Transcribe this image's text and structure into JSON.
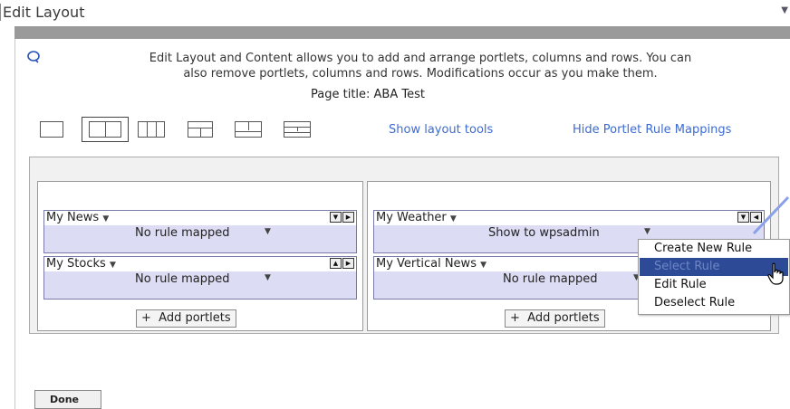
{
  "window": {
    "title": "Edit Layout"
  },
  "info": {
    "line1": "Edit Layout and Content allows you to add and arrange portlets, columns and rows. You can",
    "line2": "also remove portlets, columns and rows. Modifications occur as you make them."
  },
  "page_title": "Page title: ABA Test",
  "layout_options": [
    "one-column",
    "two-column",
    "three-column",
    "top-and-two-columns",
    "two-rows-two-columns",
    "two-rows-split"
  ],
  "selected_layout": "two-column",
  "links": {
    "show_layout_tools": "Show layout tools",
    "hide_rule_mappings": "Hide Portlet Rule Mappings"
  },
  "columns": [
    {
      "portlets": [
        {
          "title": "My News",
          "rule": "No rule mapped"
        },
        {
          "title": "My Stocks",
          "rule": "No rule mapped"
        }
      ],
      "add_label": "Add portlets"
    },
    {
      "portlets": [
        {
          "title": "My Weather",
          "rule": "Show to wpsadmin"
        },
        {
          "title": "My Vertical News",
          "rule": "No rule mapped"
        }
      ],
      "add_label": "Add portlets"
    }
  ],
  "context_menu": {
    "items": [
      "Create New Rule",
      "Select Rule",
      "Edit Rule",
      "Deselect Rule"
    ],
    "highlighted": "Select Rule"
  },
  "done_label": "Done",
  "colors": {
    "link": "#3d6bd2",
    "rule_band": "#dcdcf4",
    "menu_highlight": "#2d4a97",
    "arrow": "#8aa0e8"
  }
}
